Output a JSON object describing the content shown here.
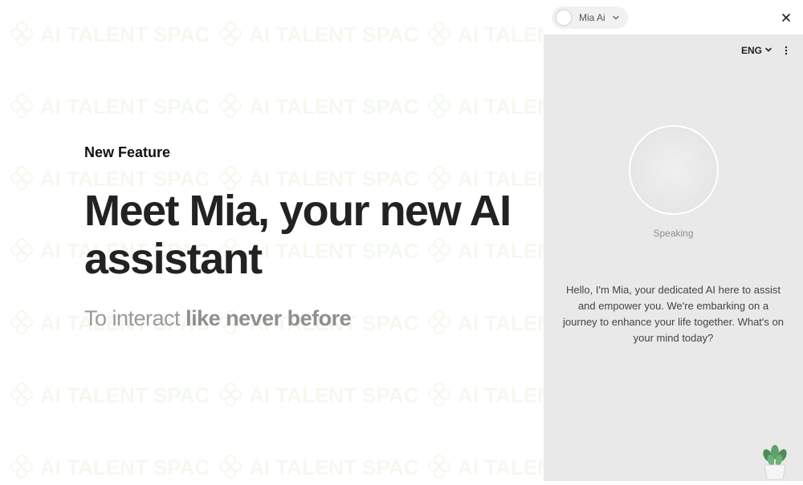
{
  "hero": {
    "eyebrow": "New Feature",
    "headline": "Meet Mia, your new AI assistant",
    "subhead_plain": "To interact ",
    "subhead_bold": "like never before"
  },
  "widget": {
    "ai_name": "Mia Ai",
    "language": "ENG",
    "status": "Speaking",
    "greeting": "Hello, I'm Mia, your dedicated AI here to assist and empower you. We're embarking on a journey to enhance your life together. What's on your mind today?"
  },
  "watermark_text": "AI TALENT SPACE"
}
